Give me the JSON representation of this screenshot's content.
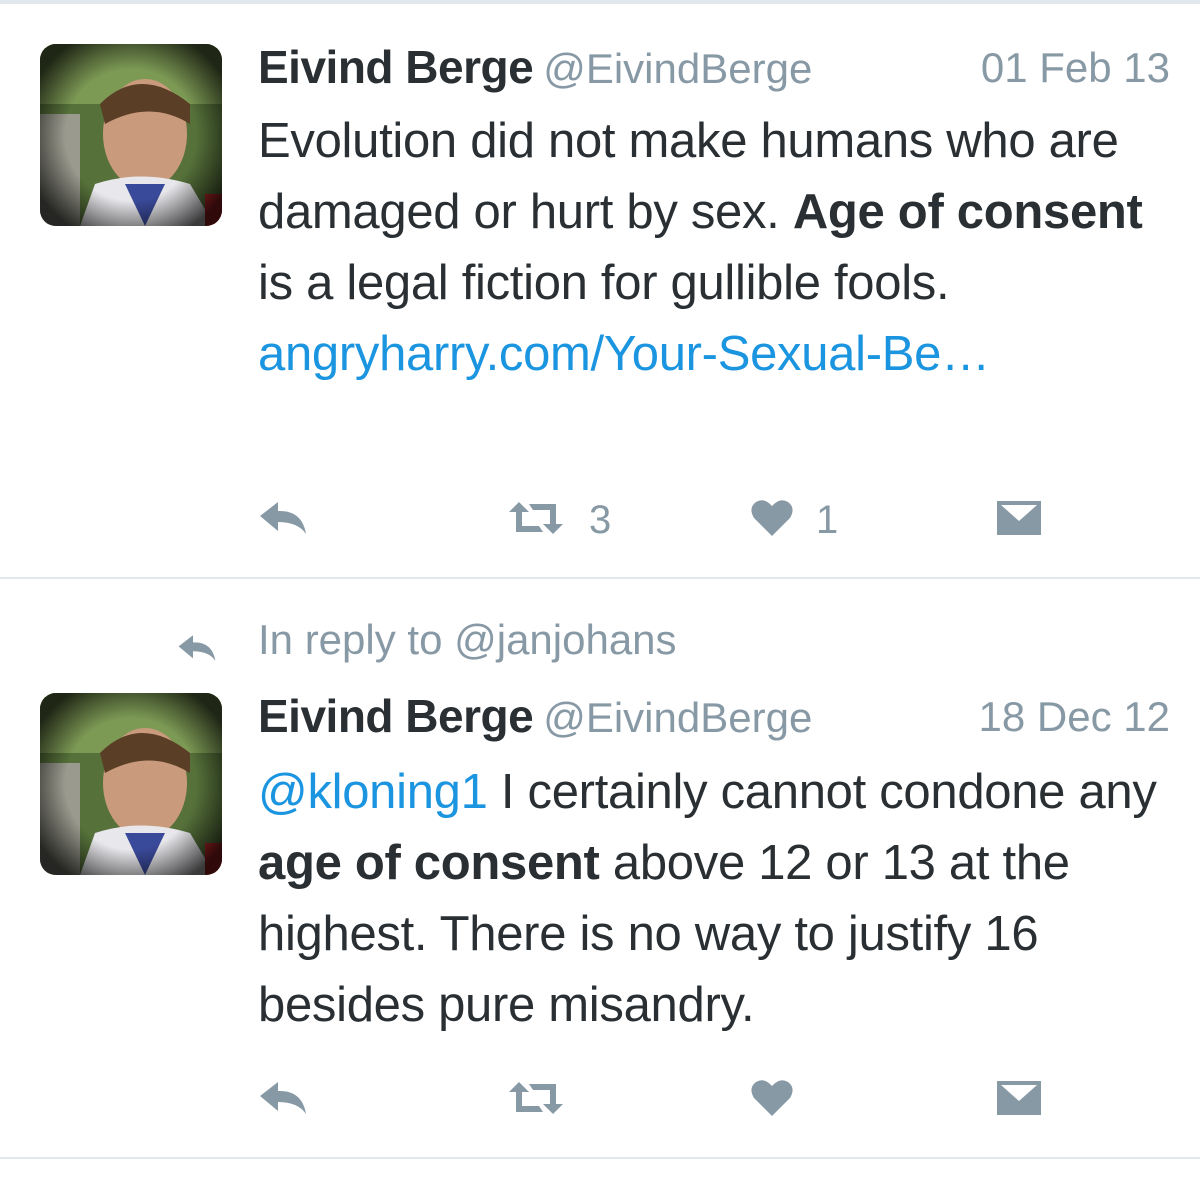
{
  "tweets": [
    {
      "author_name": "Eivind Berge",
      "author_handle": "@EivindBerge",
      "date": "01 Feb 13",
      "text_parts": {
        "p1": "Evolution did not make humans who are damaged or hurt by sex. ",
        "b1": "Age of consent",
        "p2": " is a legal fiction for gullible fools. ",
        "link": "angryharry.com/Your-Sexual-Be…"
      },
      "retweet_count": "3",
      "like_count": "1"
    },
    {
      "reply_context": "In reply to @janjohans",
      "author_name": "Eivind Berge",
      "author_handle": "@EivindBerge",
      "date": "18 Dec 12",
      "text_parts": {
        "mention": "@kloning1",
        "p1": " I certainly cannot condone any ",
        "b1": "age of consent",
        "p2": " above 12 or 13 at the highest. There is no way to justify 16 besides pure misandry."
      },
      "retweet_count": "",
      "like_count": ""
    }
  ],
  "icons": {
    "reply": "reply-arrow-icon",
    "retweet": "retweet-icon",
    "like": "heart-icon",
    "dm": "envelope-icon"
  },
  "colors": {
    "text": "#292f33",
    "secondary": "#8899a6",
    "link": "#1b95e0",
    "divider": "#e1e8ed"
  }
}
